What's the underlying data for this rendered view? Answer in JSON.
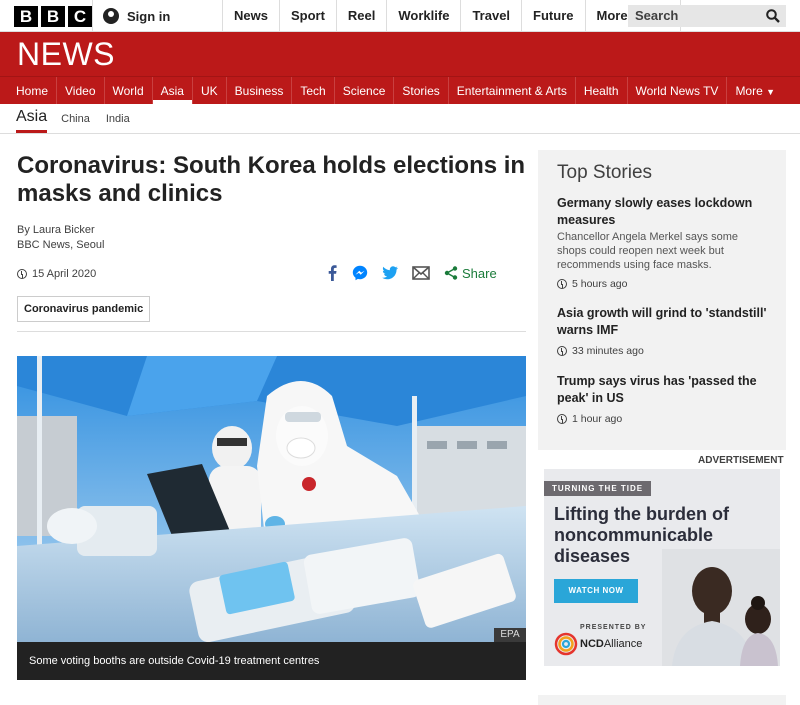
{
  "topbar": {
    "logo_letters": [
      "B",
      "B",
      "C"
    ],
    "sign_in": "Sign in",
    "nav": [
      "News",
      "Sport",
      "Reel",
      "Worklife",
      "Travel",
      "Future"
    ],
    "more": "More",
    "search_placeholder": "Search"
  },
  "header": {
    "title": "NEWS"
  },
  "main_nav": {
    "items": [
      "Home",
      "Video",
      "World",
      "Asia",
      "UK",
      "Business",
      "Tech",
      "Science",
      "Stories",
      "Entertainment & Arts",
      "Health",
      "World News TV"
    ],
    "active": "Asia",
    "more": "More"
  },
  "sub_nav": {
    "active": "Asia",
    "items": [
      "China",
      "India"
    ]
  },
  "article": {
    "headline": "Coronavirus: South Korea holds elections in masks and clinics",
    "author": "By Laura Bicker",
    "location": "BBC News, Seoul",
    "date": "15 April 2020",
    "share_label": "Share",
    "tag": "Coronavirus pandemic",
    "image_credit": "EPA",
    "caption": "Some voting booths are outside Covid-19 treatment centres"
  },
  "sidebar": {
    "title": "Top Stories",
    "stories": [
      {
        "headline": "Germany slowly eases lockdown measures",
        "summary": "Chancellor Angela Merkel says some shops could reopen next week but recommends using face masks.",
        "time": "5 hours ago"
      },
      {
        "headline": "Asia growth will grind to 'standstill' warns IMF",
        "summary": "",
        "time": "33 minutes ago"
      },
      {
        "headline": "Trump says virus has 'passed the peak' in US",
        "summary": "",
        "time": "1 hour ago"
      }
    ]
  },
  "ad": {
    "label": "ADVERTISEMENT",
    "kicker": "TURNING THE TIDE",
    "headline": "Lifting the burden of noncommunicable diseases",
    "button": "WATCH NOW",
    "presented_by": "PRESENTED BY",
    "sponsor_bold": "NCD",
    "sponsor_rest": "Alliance"
  },
  "colors": {
    "bbc_red": "#bb1919",
    "share_green": "#1a7b3a",
    "facebook": "#3b5998",
    "messenger": "#0084ff",
    "twitter": "#1da1f2",
    "ad_button": "#2aa6d8"
  }
}
